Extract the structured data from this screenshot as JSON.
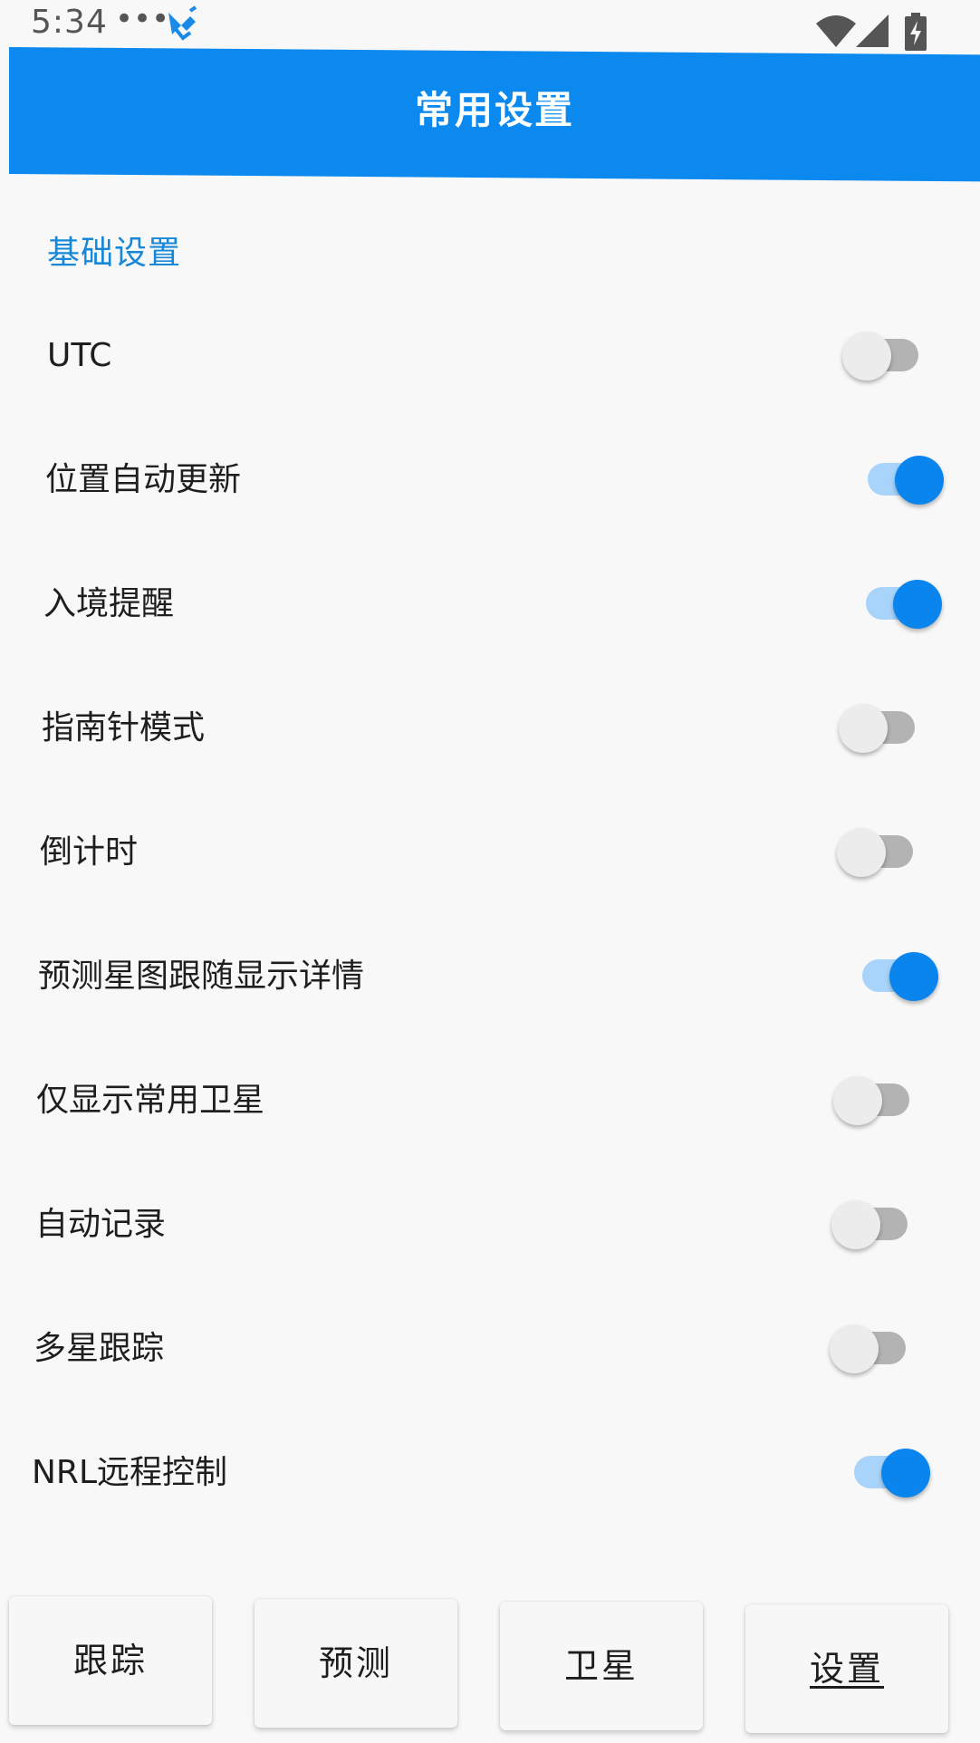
{
  "status_bar": {
    "time": "5:34",
    "dots": "•••",
    "icons": [
      "satellite-icon",
      "wifi-icon",
      "signal-icon",
      "battery-charging-icon"
    ]
  },
  "header": {
    "title": "常用设置",
    "background": "#0b89ee"
  },
  "section": {
    "title": "基础设置",
    "color": "#1788d8"
  },
  "settings": [
    {
      "label": "UTC",
      "on": false
    },
    {
      "label": "位置自动更新",
      "on": true
    },
    {
      "label": "入境提醒",
      "on": true
    },
    {
      "label": "指南针模式",
      "on": false
    },
    {
      "label": "倒计时",
      "on": false
    },
    {
      "label": "预测星图跟随显示详情",
      "on": true
    },
    {
      "label": "仅显示常用卫星",
      "on": false
    },
    {
      "label": "自动记录",
      "on": false
    },
    {
      "label": "多星跟踪",
      "on": false
    },
    {
      "label": "NRL远程控制",
      "on": true
    }
  ],
  "tabs": [
    {
      "label": "跟踪",
      "active": false
    },
    {
      "label": "预测",
      "active": false
    },
    {
      "label": "卫星",
      "active": false
    },
    {
      "label": "设置",
      "active": true
    }
  ],
  "colors": {
    "switch_on_knob": "#0b85ee",
    "switch_on_track": "#a8d4fb",
    "switch_off_knob": "#ececec",
    "switch_off_track": "#b3b3b3"
  }
}
